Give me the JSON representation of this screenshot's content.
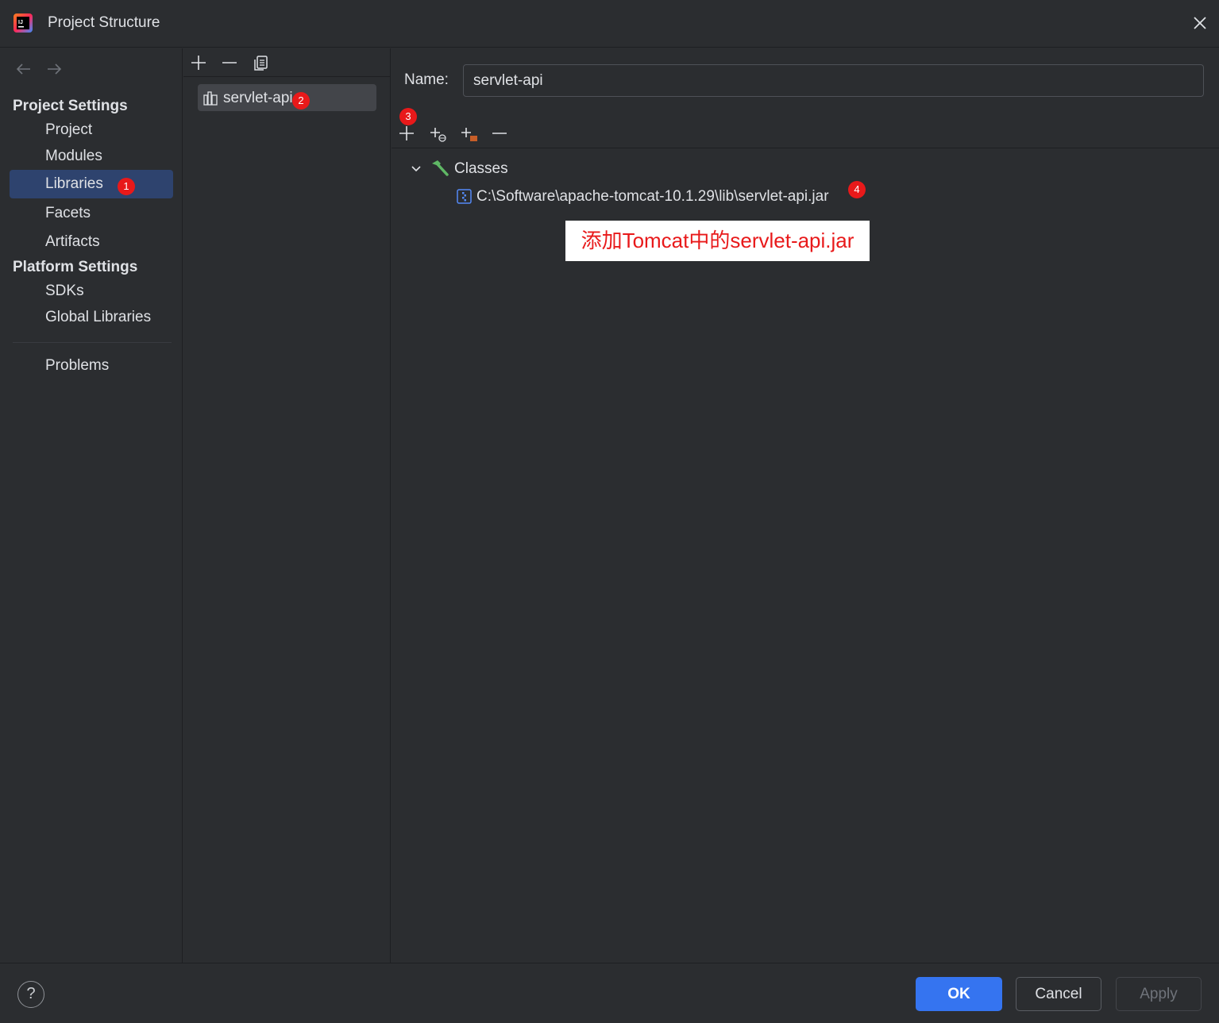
{
  "window": {
    "title": "Project Structure",
    "close_icon": "close-icon",
    "app_icon": "intellij-idea-logo"
  },
  "nav": {
    "back_icon": "arrow-left-icon",
    "forward_icon": "arrow-right-icon",
    "project_settings_header": "Project Settings",
    "platform_settings_header": "Platform Settings",
    "items": [
      {
        "label": "Project"
      },
      {
        "label": "Modules"
      },
      {
        "label": "Libraries",
        "selected": true
      },
      {
        "label": "Facets"
      },
      {
        "label": "Artifacts"
      },
      {
        "label": "SDKs"
      },
      {
        "label": "Global Libraries"
      },
      {
        "label": "Problems"
      }
    ]
  },
  "badges": {
    "b1": "1",
    "b2": "2",
    "b3": "3",
    "b4": "4",
    "color": "#e8191a"
  },
  "libraries_panel": {
    "toolbar": [
      "add-icon",
      "remove-icon",
      "copy-icon"
    ],
    "items": [
      {
        "label": "servlet-api",
        "selected": true
      }
    ]
  },
  "detail": {
    "name_label": "Name:",
    "name_value": "servlet-api",
    "toolbar": [
      "add-icon",
      "add-url-icon",
      "add-folder-icon",
      "remove-icon"
    ],
    "tree": {
      "root_label": "Classes",
      "entries": [
        {
          "path": "C:\\Software\\apache-tomcat-10.1.29\\lib\\servlet-api.jar"
        }
      ]
    },
    "annotation": "添加Tomcat中的servlet-api.jar"
  },
  "footer": {
    "help_label": "?",
    "ok_label": "OK",
    "cancel_label": "Cancel",
    "apply_label": "Apply"
  },
  "colors": {
    "background": "#2b2d30",
    "selection": "#2e436e",
    "accent": "#3574f0"
  }
}
